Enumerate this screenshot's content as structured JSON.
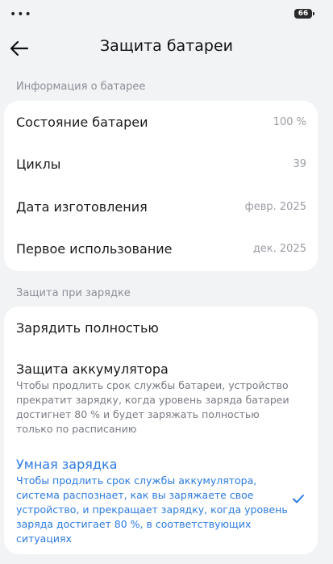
{
  "status": {
    "dots": "•••",
    "battery_level": "66"
  },
  "header": {
    "title": "Защита батареи"
  },
  "battery_info": {
    "section_label": "Информация о батарее",
    "rows": [
      {
        "label": "Состояние батареи",
        "value": "100 %"
      },
      {
        "label": "Циклы",
        "value": "39"
      },
      {
        "label": "Дата изготовления",
        "value": "февр. 2025"
      },
      {
        "label": "Первое использование",
        "value": "дек. 2025"
      }
    ]
  },
  "charging_protection": {
    "section_label": "Защита при зарядке",
    "options": [
      {
        "title": "Зарядить полностью",
        "description": "",
        "selected": false
      },
      {
        "title": "Защита аккумулятора",
        "description": "Чтобы продлить срок службы батареи, устройство прекратит зарядку, когда уровень заряда батареи достигнет 80 % и будет заряжать полностью только по расписанию",
        "selected": false
      },
      {
        "title": "Умная зарядка",
        "description": "Чтобы продлить срок службы аккумулятора, система распознает, как вы заряжаете свое устройство, и прекращает зарядку, когда уровень заряда достигает 80 %, в соответствующих ситуациях",
        "selected": true
      }
    ]
  },
  "colors": {
    "accent": "#2d7be0",
    "background": "#f2f3f5",
    "card": "#ffffff",
    "secondary_text": "#9a9da3"
  },
  "icons": {
    "back": "arrow-left-icon",
    "selected": "check-icon"
  }
}
